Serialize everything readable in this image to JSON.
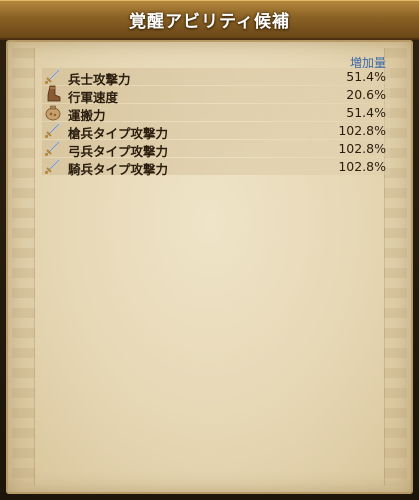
{
  "title": "覚醒アビリティ候補",
  "column_header": "増加量",
  "rows": [
    {
      "icon": "sword-icon",
      "name": "兵士攻撃力",
      "value": "51.4%"
    },
    {
      "icon": "boot-icon",
      "name": "行軍速度",
      "value": "20.6%"
    },
    {
      "icon": "sack-icon",
      "name": "運搬力",
      "value": "51.4%"
    },
    {
      "icon": "sword-icon",
      "name": "槍兵タイプ攻撃力",
      "value": "102.8%"
    },
    {
      "icon": "sword-icon",
      "name": "弓兵タイプ攻撃力",
      "value": "102.8%"
    },
    {
      "icon": "sword-icon",
      "name": "騎兵タイプ攻撃力",
      "value": "102.8%"
    }
  ],
  "colors": {
    "header_accent": "#3c6aa8",
    "title_bar": "#8a6225",
    "parchment": "#e6d7b4"
  }
}
